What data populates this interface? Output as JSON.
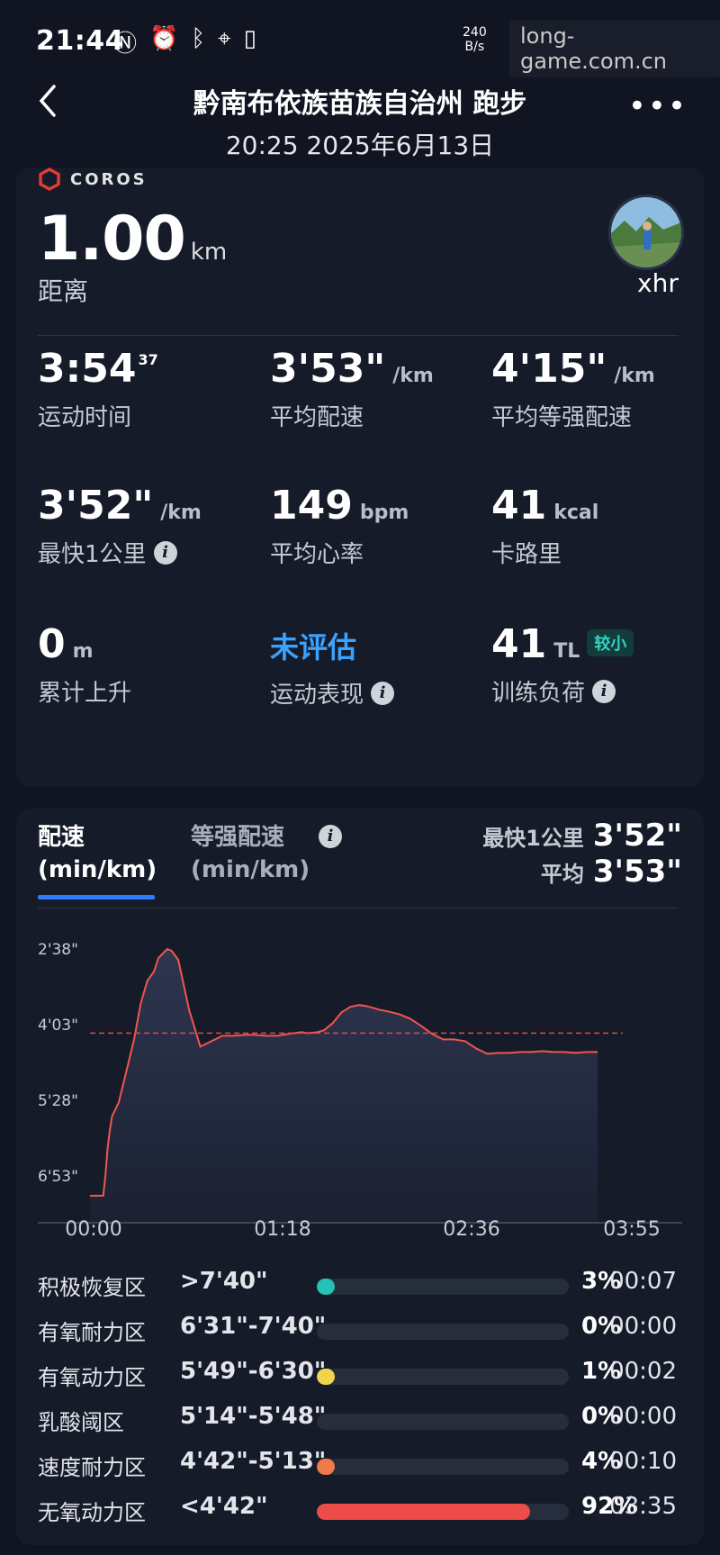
{
  "status_bar": {
    "time": "21:44",
    "icons": [
      "nfc-icon",
      "alarm-icon",
      "bluetooth-icon",
      "location-icon",
      "vibrate-icon"
    ],
    "net_speed_top": "240",
    "net_speed_bottom": "B/s",
    "watermark": "long-game.com.cn"
  },
  "header": {
    "title": "黔南布依族苗族自治州 跑步",
    "subtitle": "20:25 2025年6月13日"
  },
  "summary": {
    "brand": "COROS",
    "distance_value": "1.00",
    "distance_unit": "km",
    "distance_label": "距离",
    "username": "xhr",
    "stats": [
      {
        "value": "3:54",
        "sup": "37",
        "unit": "",
        "label": "运动时间",
        "info": false
      },
      {
        "value": "3'53\"",
        "unit": "/km",
        "label": "平均配速",
        "info": false
      },
      {
        "value": "4'15\"",
        "unit": "/km",
        "label": "平均等强配速",
        "info": false
      },
      {
        "value": "3'52\"",
        "unit": "/km",
        "label": "最快1公里",
        "info": true
      },
      {
        "value": "149",
        "unit": "bpm",
        "label": "平均心率",
        "info": false
      },
      {
        "value": "41",
        "unit": "kcal",
        "label": "卡路里",
        "info": false
      },
      {
        "value": "0",
        "unit": "m",
        "label": "累计上升",
        "info": false
      },
      {
        "value": "未评估",
        "unit": "",
        "label": "运动表现",
        "info": true
      },
      {
        "value": "41",
        "unit": "TL",
        "badge": "较小",
        "label": "训练负荷",
        "info": true
      }
    ]
  },
  "pace_card": {
    "tab_active_line1": "配速",
    "tab_active_line2": "(min/km)",
    "tab_other_line1": "等强配速",
    "tab_other_line2": "(min/km)",
    "fastest_label": "最快1公里",
    "fastest_value": "3'52\"",
    "avg_label": "平均",
    "avg_value": "3'53\""
  },
  "chart_data": {
    "type": "area",
    "y_tick_labels": [
      "2'38\"",
      "4'03\"",
      "5'28\"",
      "6'53\""
    ],
    "y_inverted": true,
    "x_tick_labels": [
      "00:00",
      "01:18",
      "02:36",
      "03:55"
    ],
    "average_line": 233,
    "x": [
      0,
      12,
      14,
      16,
      18,
      20,
      22,
      24,
      26,
      28,
      30,
      34,
      40,
      46,
      52,
      58,
      62,
      66,
      70,
      74,
      80,
      90,
      100,
      110,
      120,
      130,
      140,
      150,
      160,
      170,
      180,
      186,
      192,
      196,
      200,
      206,
      212,
      220,
      228,
      236,
      244,
      250,
      256,
      262,
      270,
      280,
      290,
      300,
      310,
      320,
      330,
      340,
      350,
      360,
      370,
      380,
      390,
      400,
      410,
      420,
      430,
      440,
      450,
      460
    ],
    "y": [
      413,
      413,
      390,
      360,
      340,
      325,
      320,
      315,
      310,
      300,
      290,
      270,
      240,
      200,
      175,
      165,
      150,
      145,
      140,
      142,
      152,
      208,
      248,
      242,
      236,
      236,
      235,
      235,
      236,
      236,
      234,
      233,
      232,
      233,
      233,
      232,
      230,
      222,
      210,
      204,
      202,
      203,
      205,
      207,
      209,
      212,
      217,
      225,
      234,
      240,
      240,
      242,
      250,
      256,
      255,
      255,
      254,
      254,
      253,
      254,
      254,
      255,
      254,
      254
    ],
    "ylim": [
      138,
      413
    ],
    "xlim": [
      0,
      460
    ],
    "colors": {
      "line": "#f0564e",
      "avg": "#e04a44",
      "fill_top": "#2e3650",
      "fill_bottom": "#1b2132"
    }
  },
  "zones": [
    {
      "name": "积极恢复区",
      "range": ">7'40\"",
      "pct_value": 3,
      "pct": "3%",
      "duration": "00:07",
      "color": "#25c2b6"
    },
    {
      "name": "有氧耐力区",
      "range": "6'31\"-7'40\"",
      "pct_value": 0,
      "pct": "0%",
      "duration": "00:00",
      "color": "#4caf50"
    },
    {
      "name": "有氧动力区",
      "range": "5'49\"-6'30\"",
      "pct_value": 1,
      "pct": "1%",
      "duration": "00:02",
      "color": "#f2d44a"
    },
    {
      "name": "乳酸阈区",
      "range": "5'14\"-5'48\"",
      "pct_value": 0,
      "pct": "0%",
      "duration": "00:00",
      "color": "#f0a04a"
    },
    {
      "name": "速度耐力区",
      "range": "4'42\"-5'13\"",
      "pct_value": 4,
      "pct": "4%",
      "duration": "00:10",
      "color": "#f07a4a"
    },
    {
      "name": "无氧动力区",
      "range": "<4'42\"",
      "pct_value": 92,
      "pct": "92%",
      "duration": "03:35",
      "color": "#ee4b4b"
    }
  ]
}
